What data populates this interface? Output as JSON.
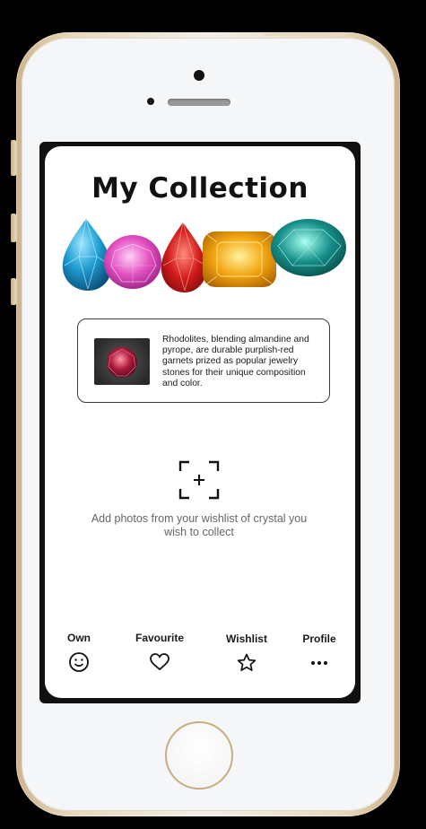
{
  "page": {
    "title": "My Collection"
  },
  "info_card": {
    "text": "Rhodolites, blending almandine and pyrope, are durable purplish-red garnets prized as popular jewelry stones for their unique composition and color.",
    "thumbnail": "rhodolite-gem"
  },
  "add_photo": {
    "icon": "add-photo-icon",
    "hint": "Add photos from your wishlist of crystal you wish to collect"
  },
  "nav": {
    "items": [
      {
        "label": "Own",
        "icon": "smiley-icon"
      },
      {
        "label": "Favourite",
        "icon": "heart-icon"
      },
      {
        "label": "Wishlist",
        "icon": "star-icon"
      },
      {
        "label": "Profile",
        "icon": "more-dots-icon"
      }
    ]
  },
  "colors": {
    "gem_blue": "#1f9fd3",
    "gem_pink": "#e24fc0",
    "gem_red": "#d31b1b",
    "gem_yellow": "#f2a50f",
    "gem_teal": "#168f8a"
  }
}
